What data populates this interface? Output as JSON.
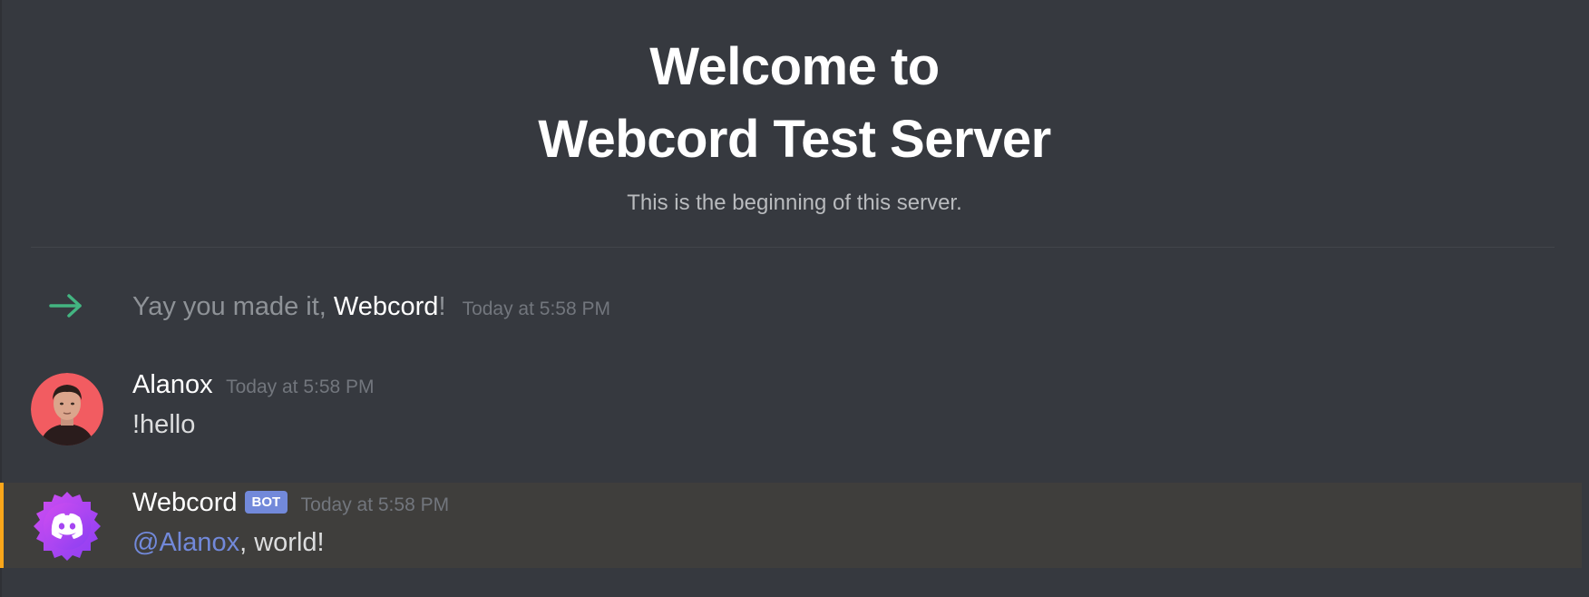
{
  "welcome": {
    "title_line1": "Welcome to",
    "title_line2": "Webcord Test Server",
    "subtitle": "This is the beginning of this server."
  },
  "system_message": {
    "icon": "join-arrow-icon",
    "prefix": "Yay you made it, ",
    "username": "Webcord",
    "suffix": "!",
    "timestamp": "Today at 5:58 PM"
  },
  "messages": [
    {
      "author": "Alanox",
      "timestamp": "Today at 5:58 PM",
      "content": "!hello"
    },
    {
      "author": "Webcord",
      "tag": "BOT",
      "timestamp": "Today at 5:58 PM",
      "mention": "@Alanox",
      "content": ", world!"
    }
  ],
  "colors": {
    "background": "#36393f",
    "join_arrow": "#43b581",
    "mention": "#7289da",
    "bot_tag": "#7289da",
    "highlight_bar": "#faa61a",
    "highlight_bg": "#3f3e3c"
  }
}
